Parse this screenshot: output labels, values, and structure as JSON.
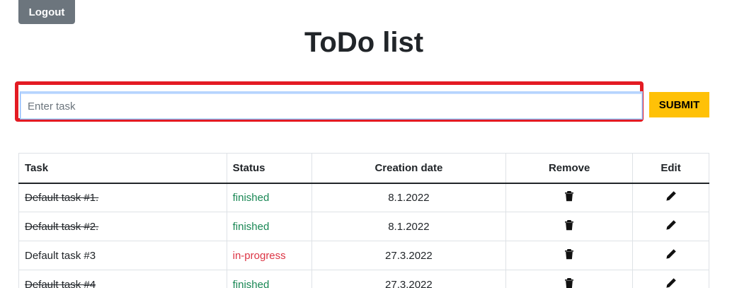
{
  "header": {
    "logout_label": "Logout",
    "title": "ToDo list"
  },
  "form": {
    "placeholder": "Enter task",
    "value": "",
    "submit_label": "SUBMIT"
  },
  "table": {
    "columns": [
      "Task",
      "Status",
      "Creation date",
      "Remove",
      "Edit"
    ],
    "rows": [
      {
        "task": "Default task #1.",
        "status": "finished",
        "date": "8.1.2022",
        "done": true
      },
      {
        "task": "Default task #2.",
        "status": "finished",
        "date": "8.1.2022",
        "done": true
      },
      {
        "task": "Default task #3",
        "status": "in-progress",
        "date": "27.3.2022",
        "done": false
      },
      {
        "task": "Default task #4",
        "status": "finished",
        "date": "27.3.2022",
        "done": true
      }
    ]
  },
  "icons": {
    "remove": "trash-icon",
    "edit": "pencil-icon"
  },
  "colors": {
    "finished": "#198754",
    "in_progress": "#dc3545",
    "submit": "#ffc107",
    "logout": "#6c757d",
    "highlight": "#e31b23"
  }
}
